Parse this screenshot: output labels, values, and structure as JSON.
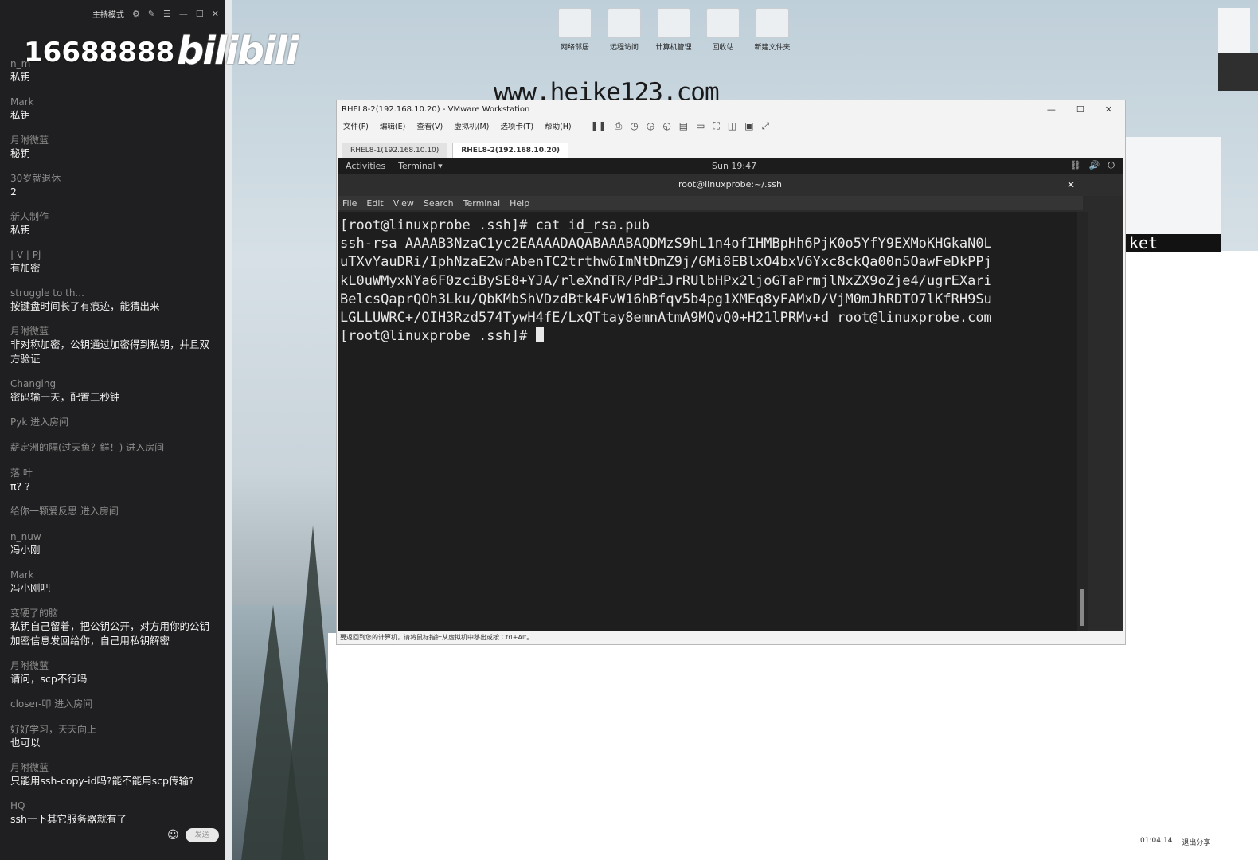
{
  "watermarks": {
    "number": "16688888",
    "brand": "bilibili",
    "url": "www.heike123.com"
  },
  "chat": {
    "top_label": "主持模式",
    "messages": [
      {
        "user": "n_m",
        "text": "私钥"
      },
      {
        "user": "Mark",
        "text": "私钥"
      },
      {
        "user": "月附微蓝",
        "text": "秘钥"
      },
      {
        "user": "30岁就退休",
        "text": "2"
      },
      {
        "user": "新人制作",
        "text": "私钥"
      },
      {
        "user": "|  V  |  Pj",
        "text": "有加密"
      },
      {
        "user": "struggle to th...",
        "text": "按键盘时间长了有痕迹，能猜出来"
      },
      {
        "user": "月附微蓝",
        "text": "非对称加密，公钥通过加密得到私钥，并且双方验证"
      },
      {
        "user": "Changing",
        "text": "密码输一天，配置三秒钟"
      }
    ],
    "system1": "Pyk 进入房间",
    "system2": "薪定洲的隔(过天鱼？鲜！) 进入房间",
    "messages2": [
      {
        "user": "落  叶",
        "text": "π? ?"
      }
    ],
    "system3": "给你一颗爱反思 进入房间",
    "messages3": [
      {
        "user": "n_nuw",
        "text": "冯小刚"
      },
      {
        "user": "Mark",
        "text": "冯小刚吧"
      },
      {
        "user": "变硬了的脑",
        "text": "私钥自己留着，把公钥公开，对方用你的公钥加密信息发回给你，自己用私钥解密"
      },
      {
        "user": "月附微蓝",
        "text": "请问，scp不行吗"
      }
    ],
    "system4": "closer-叩      进入房间",
    "messages4": [
      {
        "user": "好好学习，天天向上",
        "text": "也可以"
      },
      {
        "user": "月附微蓝",
        "text": "只能用ssh-copy-id吗?能不能用scp传输?"
      },
      {
        "user": "HQ",
        "text": "ssh一下其它服务器就有了"
      }
    ],
    "send_label": "发送"
  },
  "desktop_icons": [
    "网络邻居",
    "远程访问",
    "计算机管理",
    "回收站",
    "新建文件夹"
  ],
  "vmware": {
    "title": "RHEL8-2(192.168.10.20) - VMware Workstation",
    "menu": [
      "文件(F)",
      "编辑(E)",
      "查看(V)",
      "虚拟机(M)",
      "选项卡(T)",
      "帮助(H)"
    ],
    "tabs": [
      "RHEL8-1(192.168.10.10)",
      "RHEL8-2(192.168.10.20)"
    ],
    "status": "要返回到您的计算机，请将鼠标指针从虚拟机中移出或按 Ctrl+Alt。"
  },
  "gnome": {
    "activities": "Activities",
    "app": "Terminal ▾",
    "clock": "Sun 19:47"
  },
  "terminal": {
    "title": "root@linuxprobe:~/.ssh",
    "menu": [
      "File",
      "Edit",
      "View",
      "Search",
      "Terminal",
      "Help"
    ],
    "lines": [
      "[root@linuxprobe .ssh]# cat id_rsa.pub",
      "ssh-rsa AAAAB3NzaC1yc2EAAAADAQABAAABAQDMzS9hL1n4ofIHMBpHh6PjK0o5YfY9EXMoKHGkaN0L",
      "uTXvYauDRi/IphNzaE2wrAbenTC2trthw6ImNtDmZ9j/GMi8EBlxO4bxV6Yxc8ckQa00n5OawFeDkPPj",
      "kL0uWMyxNYa6F0zciBySE8+YJA/rleXndTR/PdPiJrRUlbHPx2ljoGTaPrmjlNxZX9oZje4/ugrEXari",
      "BelcsQaprQOh3Lku/QbKMbShVDzdBtk4FvW16hBfqv5b4pg1XMEq8yFAMxD/VjM0mJhRDTO7lKfRH9Su",
      "LGLLUWRC+/OIH3Rzd574TywH4fE/LxQTtay8emnAtmA9MQvQ0+H21lPRMv+d root@linuxprobe.com"
    ],
    "prompt": "[root@linuxprobe .ssh]# "
  },
  "right_text": "ket",
  "bottom_right": {
    "time": "01:04:14",
    "share": "退出分享"
  }
}
